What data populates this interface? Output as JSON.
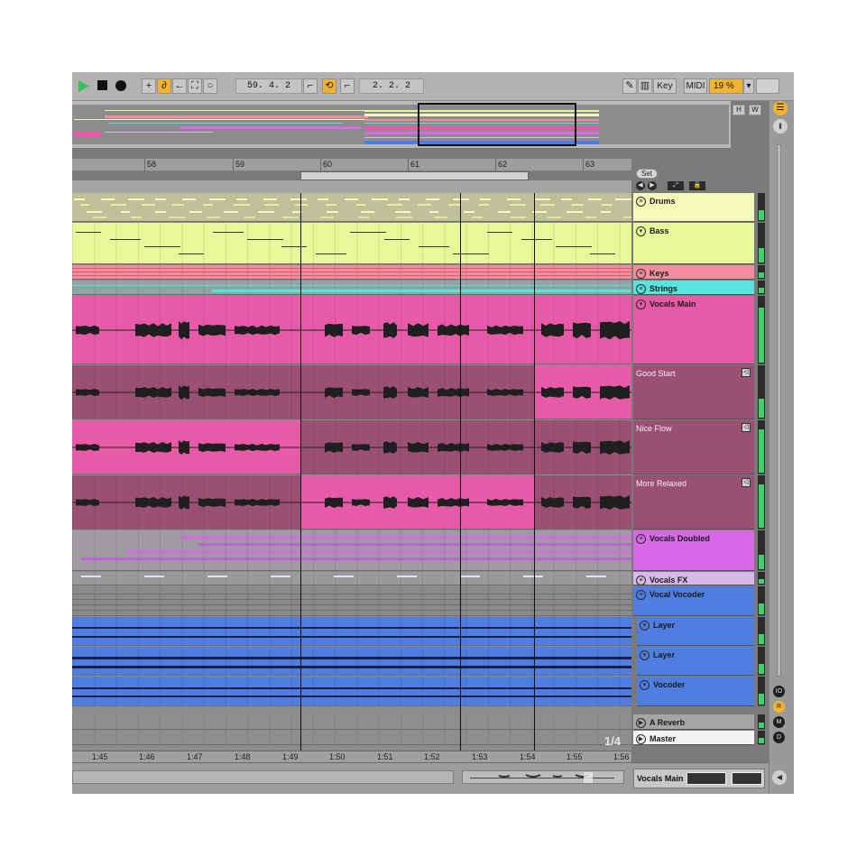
{
  "transport": {
    "play_icon": "play-icon",
    "stop_icon": "stop-icon",
    "record_icon": "record-icon",
    "position": "59.  4.  2",
    "loop_length": "2.  2.  2",
    "key_label": "Key",
    "midi_label": "MIDI",
    "cpu": "19 %",
    "cpu_caret": "▾"
  },
  "overview": {
    "h_label": "H",
    "w_label": "W"
  },
  "ruler": {
    "bars": [
      "58",
      "59",
      "60",
      "61",
      "62",
      "63"
    ],
    "set_label": "Set"
  },
  "tracks": [
    {
      "name": "Drums",
      "color": "#f4f8b8",
      "fold": "≡"
    },
    {
      "name": "Bass",
      "color": "#eaf69a",
      "fold": "▾"
    },
    {
      "name": "Keys",
      "color": "#f48e9e",
      "fold": "≡"
    },
    {
      "name": "Strings",
      "color": "#55e5dc",
      "fold": "≡"
    },
    {
      "name": "Vocals Main",
      "color": "#e75aa8",
      "fold": "▾"
    },
    {
      "name": "Good Start",
      "color": "#9b4f72",
      "fold": ""
    },
    {
      "name": "Nice Flow",
      "color": "#9b4f72",
      "fold": ""
    },
    {
      "name": "More Relaxed",
      "color": "#9b4f72",
      "fold": ""
    },
    {
      "name": "Vocals Doubled",
      "color": "#d768e6",
      "fold": "≡"
    },
    {
      "name": "Vocals FX",
      "color": "#d7b8e8",
      "fold": "≡"
    },
    {
      "name": "Vocal Vocoder",
      "color": "#4f7ee0",
      "fold": "≡"
    },
    {
      "name": "Layer",
      "color": "#4f7ee0",
      "fold": "▾"
    },
    {
      "name": "Layer",
      "color": "#4f7ee0",
      "fold": "▾"
    },
    {
      "name": "Vocoder",
      "color": "#4f7ee0",
      "fold": "▾"
    },
    {
      "name": "A Reverb",
      "color": "#a6a6a6",
      "fold": "▶"
    },
    {
      "name": "Master",
      "color": "#f4f4f4",
      "fold": "▶"
    }
  ],
  "right_strip": [
    "IO",
    "R",
    "M",
    "D"
  ],
  "grid_quantization": "1/4",
  "time_ruler": [
    "1:45",
    "1:46",
    "1:47",
    "1:48",
    "1:49",
    "1:50",
    "1:51",
    "1:52",
    "1:53",
    "1:54",
    "1:55",
    "1:56"
  ],
  "status": {
    "selected_track": "Vocals Main"
  },
  "colors": {
    "accent": "#f2b430",
    "play": "#3ac25a",
    "vocal_pink": "#e75aa8",
    "vocal_muted": "#9b4f72",
    "vocoder_blue": "#4f7ee0"
  }
}
